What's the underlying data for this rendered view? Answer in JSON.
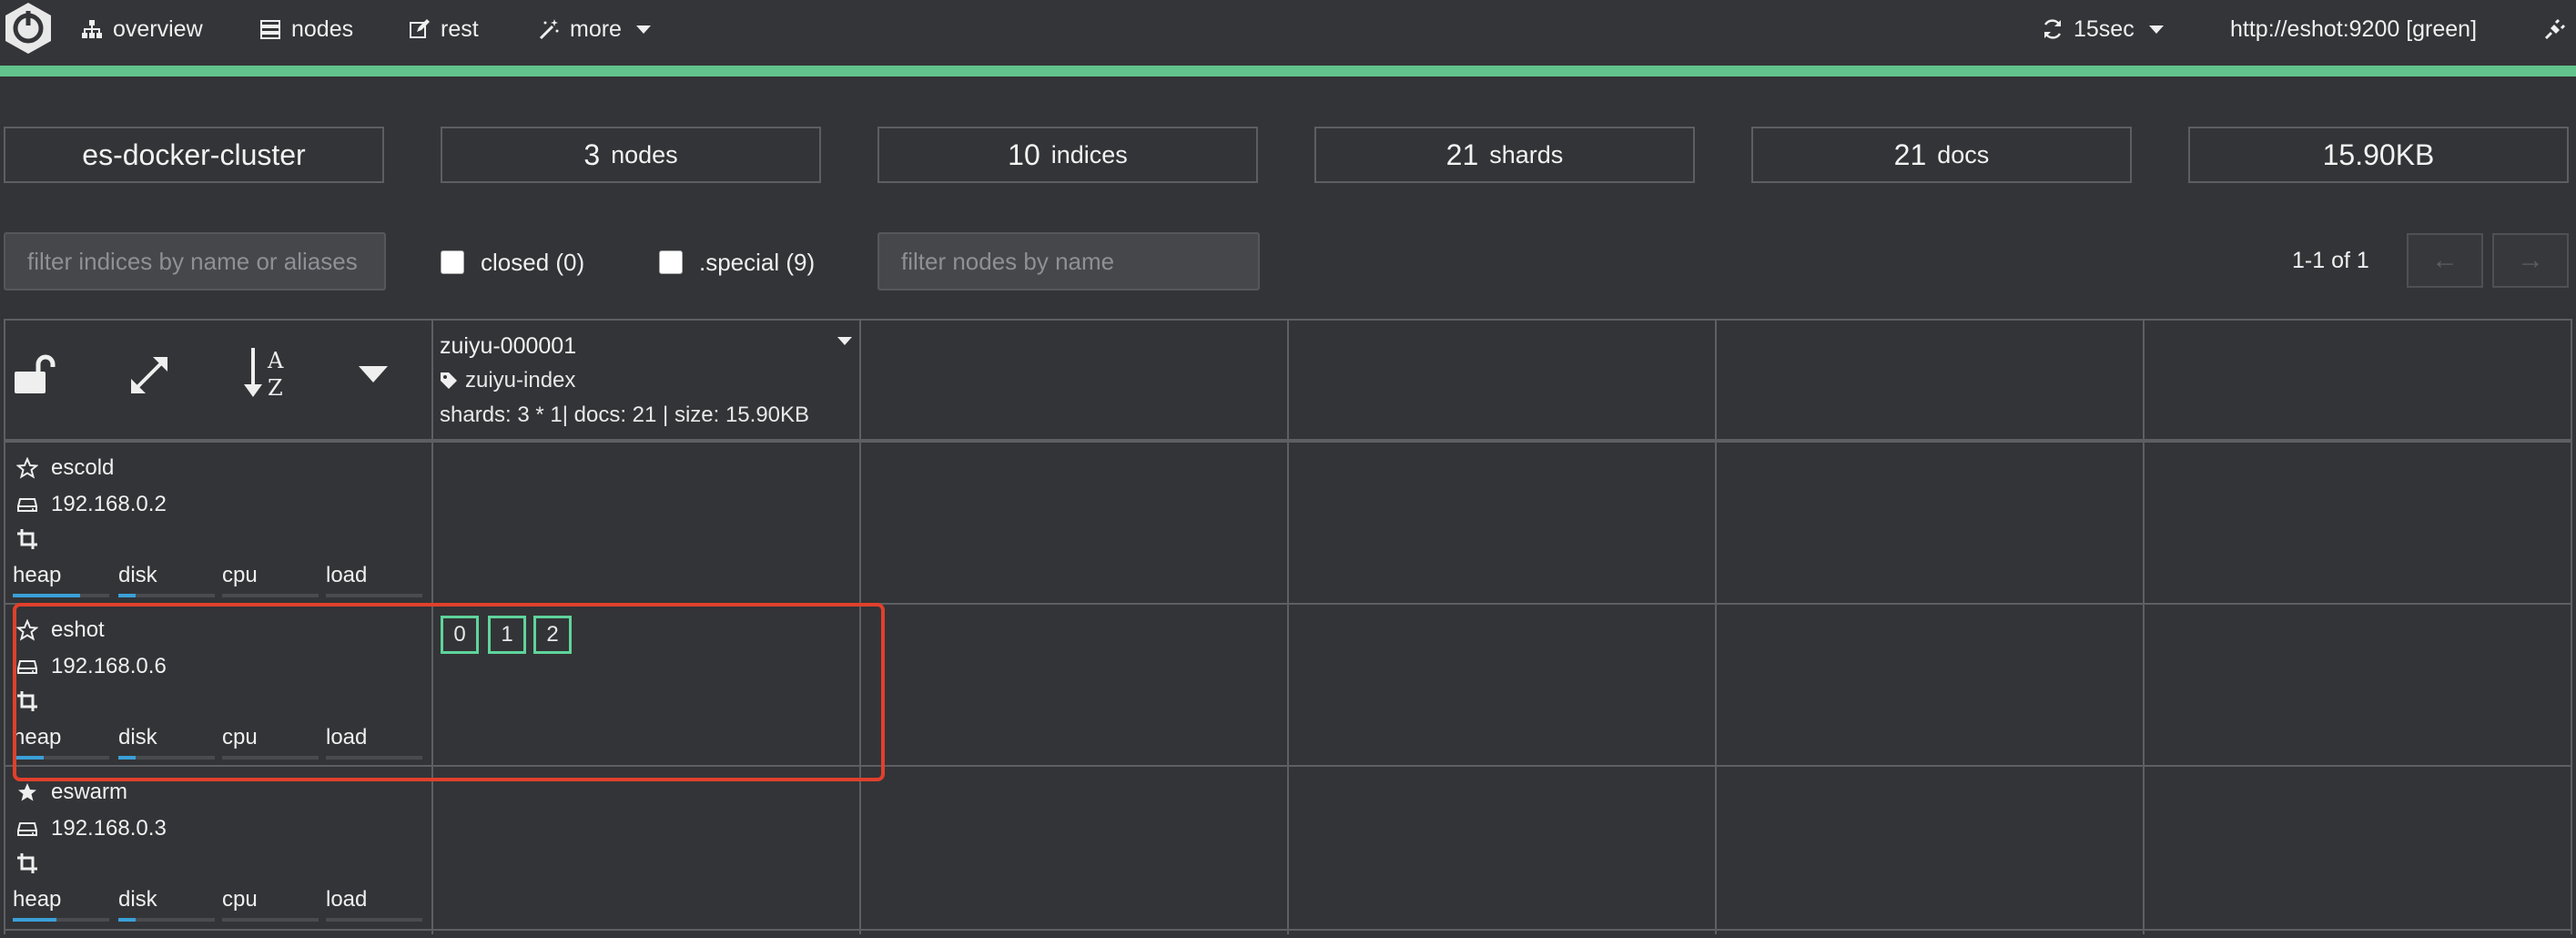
{
  "nav": {
    "overview": "overview",
    "nodes": "nodes",
    "rest": "rest",
    "more": "more",
    "refresh": "15sec",
    "connection": "http://eshot:9200 [green]"
  },
  "stats": {
    "cluster": "es-docker-cluster",
    "nodes_count": "3",
    "nodes_unit": "nodes",
    "indices_count": "10",
    "indices_unit": "indices",
    "shards_count": "21",
    "shards_unit": "shards",
    "docs_count": "21",
    "docs_unit": "docs",
    "size": "15.90KB"
  },
  "filters": {
    "indices_placeholder": "filter indices by name or aliases",
    "closed_label": "closed (0)",
    "special_label": ".special (9)",
    "nodes_placeholder": "filter nodes by name",
    "pager_text": "1-1 of 1",
    "prev": "←",
    "next": "→"
  },
  "index": {
    "name": "zuiyu-000001",
    "alias": "zuiyu-index",
    "stats": "shards: 3 * 1| docs: 21 | size: 15.90KB"
  },
  "nodes": [
    {
      "name": "escold",
      "ip": "192.168.0.2",
      "master": false,
      "heap": 0.7,
      "disk": 0.18
    },
    {
      "name": "eshot",
      "ip": "192.168.0.6",
      "master": false,
      "heap": 0.32,
      "disk": 0.18
    },
    {
      "name": "eswarm",
      "ip": "192.168.0.3",
      "master": true,
      "heap": 0.45,
      "disk": 0.18
    }
  ],
  "metric_labels": {
    "heap": "heap",
    "disk": "disk",
    "cpu": "cpu",
    "load": "load"
  },
  "shards": [
    "0",
    "1",
    "2"
  ],
  "colors": {
    "cluster_status": "#62c48c",
    "shard_border": "#5fd49b",
    "highlight": "#e0402c",
    "metric_fill": "#3aa0d8"
  }
}
